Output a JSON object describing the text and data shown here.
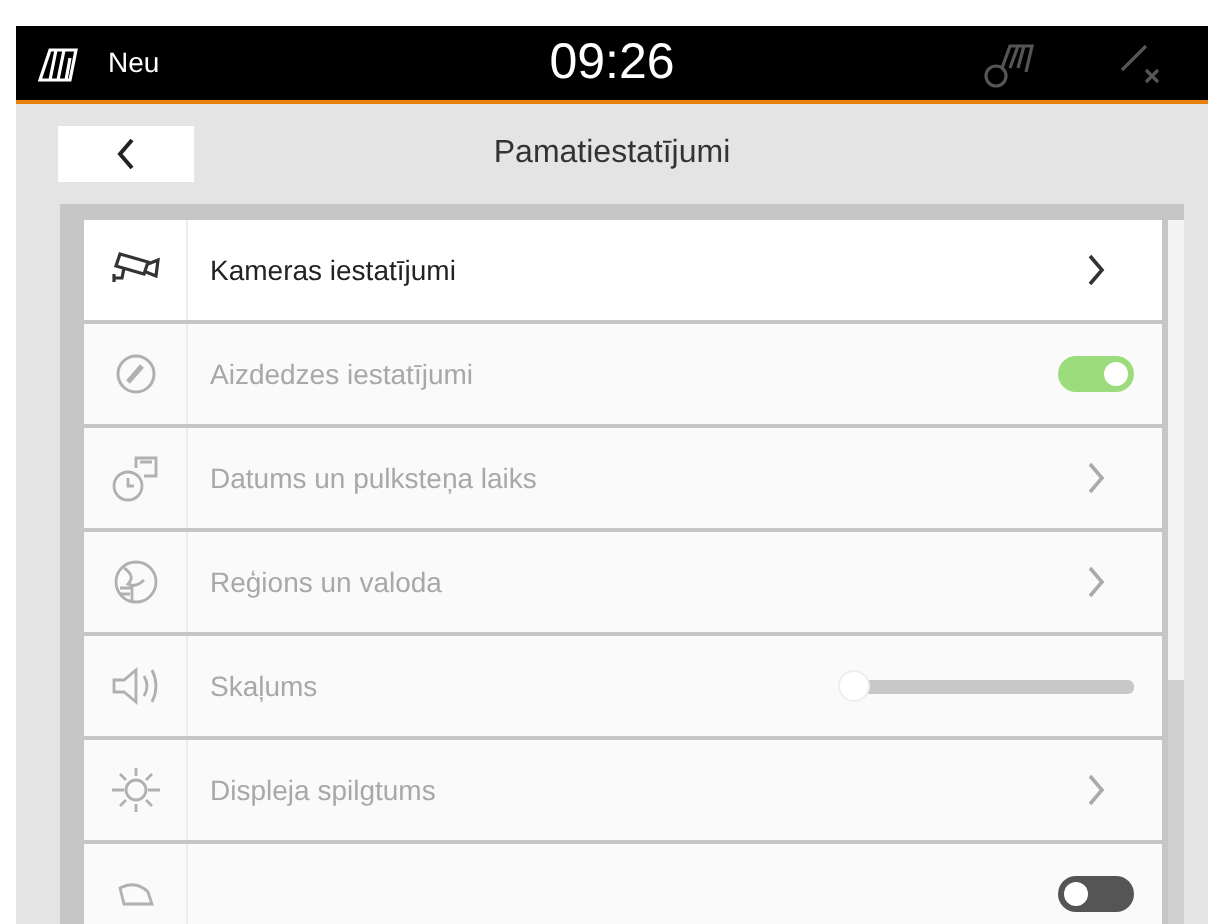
{
  "status_bar": {
    "label": "Neu",
    "time": "09:26"
  },
  "header": {
    "title": "Pamatiestatījumi"
  },
  "settings": [
    {
      "kind": "link",
      "label": "Kameras iestatījumi",
      "disabled": false
    },
    {
      "kind": "toggle",
      "label": "Aizdedzes iestatījumi",
      "disabled": true,
      "on": true
    },
    {
      "kind": "link",
      "label": "Datums un pulksteņa laiks",
      "disabled": true
    },
    {
      "kind": "link",
      "label": "Reģions un valoda",
      "disabled": true
    },
    {
      "kind": "slider",
      "label": "Skaļums",
      "disabled": true,
      "level": 0
    },
    {
      "kind": "link",
      "label": "Displeja spilgtums",
      "disabled": true
    },
    {
      "kind": "toggle",
      "disabled": true,
      "on": false
    }
  ]
}
